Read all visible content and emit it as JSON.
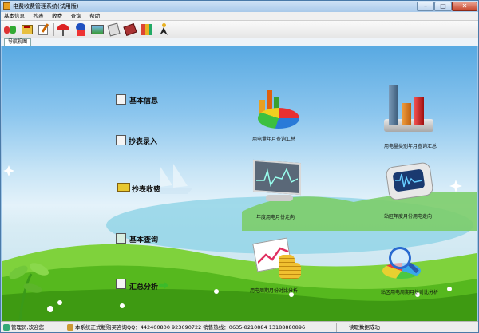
{
  "window": {
    "title": "电费收费管理系统(试用版)",
    "min": "–",
    "max": "□",
    "close": "✕"
  },
  "menu": [
    "基本信息",
    "抄表",
    "收费",
    "查询",
    "帮助"
  ],
  "toolbar": {
    "icons": [
      "users-icon",
      "book-icon",
      "write-icon",
      "umbrella-icon",
      "cartoon-icon",
      "picture-icon",
      "notebook-icon",
      "binder-icon",
      "runner-icon"
    ]
  },
  "tabs": {
    "active": "导航视图"
  },
  "nav": [
    {
      "id": "basic-info",
      "label": "基本信息"
    },
    {
      "id": "meter-input",
      "label": "抄表录入"
    },
    {
      "id": "meter-fee",
      "label": "抄表收费"
    },
    {
      "id": "basic-query",
      "label": "基本查询"
    },
    {
      "id": "summary",
      "label": "汇总分析"
    }
  ],
  "charts": [
    {
      "id": "monthly-usage",
      "caption": "用电量年月查询汇总"
    },
    {
      "id": "category-usage",
      "caption": "用电量类别年月查询汇总"
    },
    {
      "id": "annual-trend",
      "caption": "年度用电月份走向"
    },
    {
      "id": "station-trend",
      "caption": "站区年度月份用电走向"
    },
    {
      "id": "period-compare",
      "caption": "用电周期月份对比分析"
    },
    {
      "id": "station-period-compare",
      "caption": "站区用电周期月份对比分析"
    }
  ],
  "status": {
    "user": "管理员,欢迎您",
    "contact": "本系统正式版购买咨询QQ：442400800  923690722  销售热线：0635-8210884  13188880896",
    "data": "读取数据成功"
  },
  "colors": {
    "accent": "#4a7aa8",
    "grass": "#5cc42c",
    "sky": "#58a9e2"
  }
}
